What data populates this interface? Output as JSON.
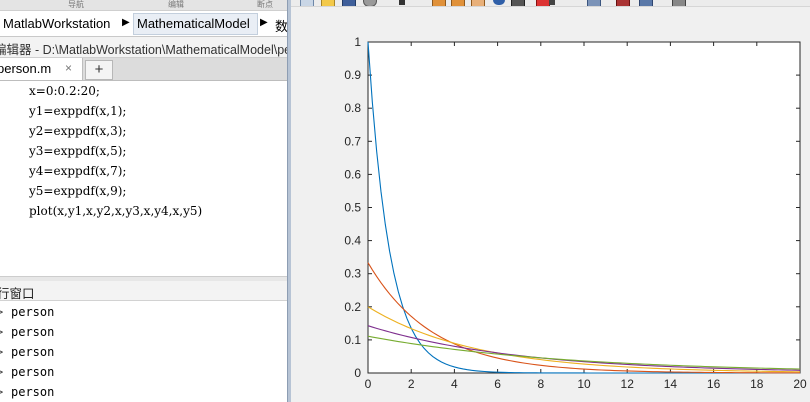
{
  "toolstrip": {
    "nav_label": "导航",
    "edit_label": "编辑",
    "breakpoint_label": "断点"
  },
  "address_bar": {
    "crumbs": [
      "MatlabWorkstation",
      "MathematicalModel",
      "数"
    ]
  },
  "editor": {
    "title": "编辑器 - D:\\MatlabWorkstation\\MathematicalModel\\person.m",
    "tab": {
      "file_name": "person.m",
      "close_symbol": "×"
    },
    "add_tab_symbol": "+",
    "lines": [
      "x=0:0.2:20;",
      "y1=exppdf(x,1);",
      "y2=exppdf(x,3);",
      "y3=exppdf(x,5);",
      "y4=exppdf(x,7);",
      "y5=exppdf(x,9);",
      "plot(x,y1,x,y2,x,y3,x,y4,x,y5)"
    ]
  },
  "command_window": {
    "title": "行窗口",
    "prompt_symbol": ">",
    "lines": [
      "person",
      "person",
      "person",
      "person",
      "person"
    ]
  },
  "figure": {
    "toolbar_icons": [
      "new-figure-icon",
      "open-file-icon",
      "save-icon",
      "print-icon",
      "pointer-icon",
      "zoom-in-icon",
      "zoom-out-icon",
      "pan-icon",
      "rotate-icon",
      "data-cursor-icon",
      "brush-icon",
      "link-icon",
      "colorbar-icon",
      "legend-icon",
      "hide-plot-tools-icon",
      "show-plot-tools-icon"
    ]
  },
  "chart_data": {
    "type": "line",
    "title": "",
    "xlabel": "",
    "ylabel": "",
    "xlim": [
      0,
      20
    ],
    "ylim": [
      0,
      1
    ],
    "grid": false,
    "legend": "none",
    "x_ticks": [
      "0",
      "2",
      "4",
      "6",
      "8",
      "10",
      "12",
      "14",
      "16",
      "18",
      "20"
    ],
    "y_ticks": [
      "0",
      "0.1",
      "0.2",
      "0.3",
      "0.4",
      "0.5",
      "0.6",
      "0.7",
      "0.8",
      "0.9",
      "1"
    ],
    "x_range": {
      "start": 0,
      "step": 0.2,
      "end": 20
    },
    "series": [
      {
        "mu": 1,
        "color": "#0072bd"
      },
      {
        "mu": 3,
        "color": "#d95319"
      },
      {
        "mu": 5,
        "color": "#edb120"
      },
      {
        "mu": 7,
        "color": "#7e2f8e"
      },
      {
        "mu": 9,
        "color": "#77ac30"
      }
    ]
  }
}
